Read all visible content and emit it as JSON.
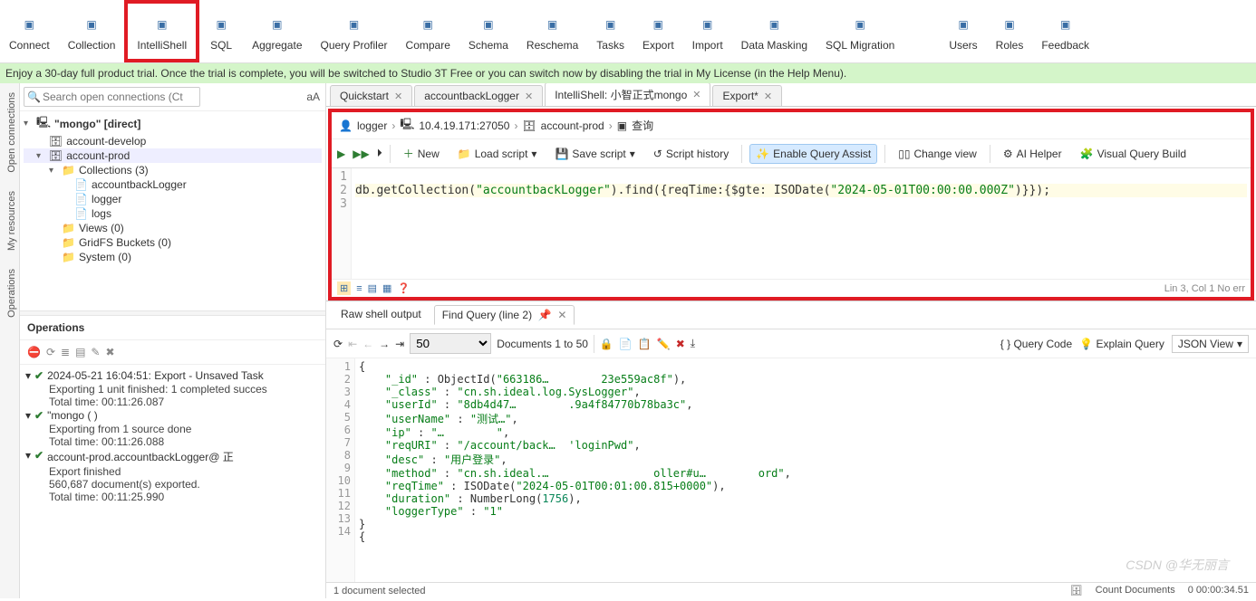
{
  "toolbar": {
    "items": [
      {
        "label": "Connect",
        "icon": "connect-icon"
      },
      {
        "label": "Collection",
        "icon": "collection-icon"
      },
      {
        "label": "IntelliShell",
        "icon": "intellishell-icon",
        "highlight": true
      },
      {
        "label": "SQL",
        "icon": "sql-icon"
      },
      {
        "label": "Aggregate",
        "icon": "aggregate-icon"
      },
      {
        "label": "Query Profiler",
        "icon": "profiler-icon"
      },
      {
        "label": "Compare",
        "icon": "compare-icon"
      },
      {
        "label": "Schema",
        "icon": "schema-icon"
      },
      {
        "label": "Reschema",
        "icon": "reschema-icon"
      },
      {
        "label": "Tasks",
        "icon": "tasks-icon"
      },
      {
        "label": "Export",
        "icon": "export-icon"
      },
      {
        "label": "Import",
        "icon": "import-icon"
      },
      {
        "label": "Data Masking",
        "icon": "masking-icon"
      },
      {
        "label": "SQL Migration",
        "icon": "migration-icon"
      },
      {
        "label": "Users",
        "icon": "users-icon"
      },
      {
        "label": "Roles",
        "icon": "roles-icon"
      },
      {
        "label": "Feedback",
        "icon": "feedback-icon"
      }
    ]
  },
  "trial_message": "Enjoy a 30-day full product trial. Once the trial is complete, you will be switched to Studio 3T Free or you can switch now by disabling the trial in My License (in the Help Menu).",
  "side_tabs": [
    "Open connections",
    "My resources",
    "Operations"
  ],
  "search_placeholder": "Search open connections (Ctrl+F)",
  "tree": {
    "root_label": "\"mongo\" [direct]",
    "nodes": [
      {
        "label": "account-develop",
        "type": "db",
        "indent": 1
      },
      {
        "label": "account-prod",
        "type": "db",
        "indent": 1,
        "expanded": true,
        "selected": true
      },
      {
        "label": "Collections (3)",
        "type": "folder",
        "indent": 2,
        "expanded": true
      },
      {
        "label": "accountbackLogger",
        "type": "coll",
        "indent": 3
      },
      {
        "label": "logger",
        "type": "coll",
        "indent": 3
      },
      {
        "label": "logs",
        "type": "coll",
        "indent": 3
      },
      {
        "label": "Views (0)",
        "type": "folder",
        "indent": 2
      },
      {
        "label": "GridFS Buckets (0)",
        "type": "folder",
        "indent": 2
      },
      {
        "label": "System (0)",
        "type": "folder",
        "indent": 2
      }
    ]
  },
  "operations_header": "Operations",
  "operations": [
    {
      "title": "2024-05-21 16:04:51:  Export - Unsaved Task",
      "lines": [
        "Exporting 1 unit finished: 1 completed succes",
        "Total time: 00:11:26.087"
      ]
    },
    {
      "title": "\"mongo (                    )",
      "lines": [
        "Exporting from 1 source done",
        "Total time: 00:11:26.088"
      ]
    },
    {
      "title": "account-prod.accountbackLogger@    正",
      "lines": [
        "Export finished",
        "560,687 document(s) exported.",
        "Total time: 00:11:25.990"
      ]
    }
  ],
  "tabs": [
    {
      "label": "Quickstart",
      "closable": true
    },
    {
      "label": "accountbackLogger",
      "closable": true
    },
    {
      "label": "IntelliShell: 小智正式mongo",
      "closable": true,
      "active": true
    },
    {
      "label": "Export*",
      "closable": true
    }
  ],
  "breadcrumb": {
    "user": "logger",
    "host": "10.4.19.171:27050",
    "db": "account-prod",
    "shell": "查询"
  },
  "toolbar2": {
    "new": "New",
    "load": "Load script",
    "save": "Save script",
    "history": "Script history",
    "assist": "Enable Query Assist",
    "view": "Change view",
    "ai": "AI Helper",
    "visual": "Visual Query Build"
  },
  "editor": {
    "lines": [
      "",
      "db.getCollection(\"accountbackLogger\").find({reqTime:{$gte: ISODate(\"2024-05-01T00:00:00.000Z\")}});",
      ""
    ],
    "status": "Lin 3, Col 1  No err"
  },
  "result_tabs": {
    "raw": "Raw shell output",
    "find": "Find Query (line 2)"
  },
  "result_toolbar": {
    "page_size": "50",
    "doc_range": "Documents 1 to 50",
    "query_code": "Query Code",
    "explain": "Explain Query",
    "view": "JSON View"
  },
  "json_output": [
    "{",
    "    \"_id\" : ObjectId(\"663186…        23e559ac8f\"),",
    "    \"_class\" : \"cn.sh.ideal.log.SysLogger\",",
    "    \"userId\" : \"8db4d47…        .9a4f84770b78ba3c\",",
    "    \"userName\" : \"测试…\",",
    "    \"ip\" : \"…        \",",
    "    \"reqURI\" : \"/account/back…  'loginPwd\",",
    "    \"desc\" : \"用户登录\",",
    "    \"method\" : \"cn.sh.ideal.…                oller#u…        ord\",",
    "    \"reqTime\" : ISODate(\"2024-05-01T00:01:00.815+0000\"),",
    "    \"duration\" : NumberLong(1756),",
    "    \"loggerType\" : \"1\"",
    "}",
    "{"
  ],
  "statusbar": {
    "left": "1 document selected",
    "count": "Count Documents",
    "elapsed": "0 00:00:34.51"
  },
  "watermark": "CSDN @华无丽言"
}
